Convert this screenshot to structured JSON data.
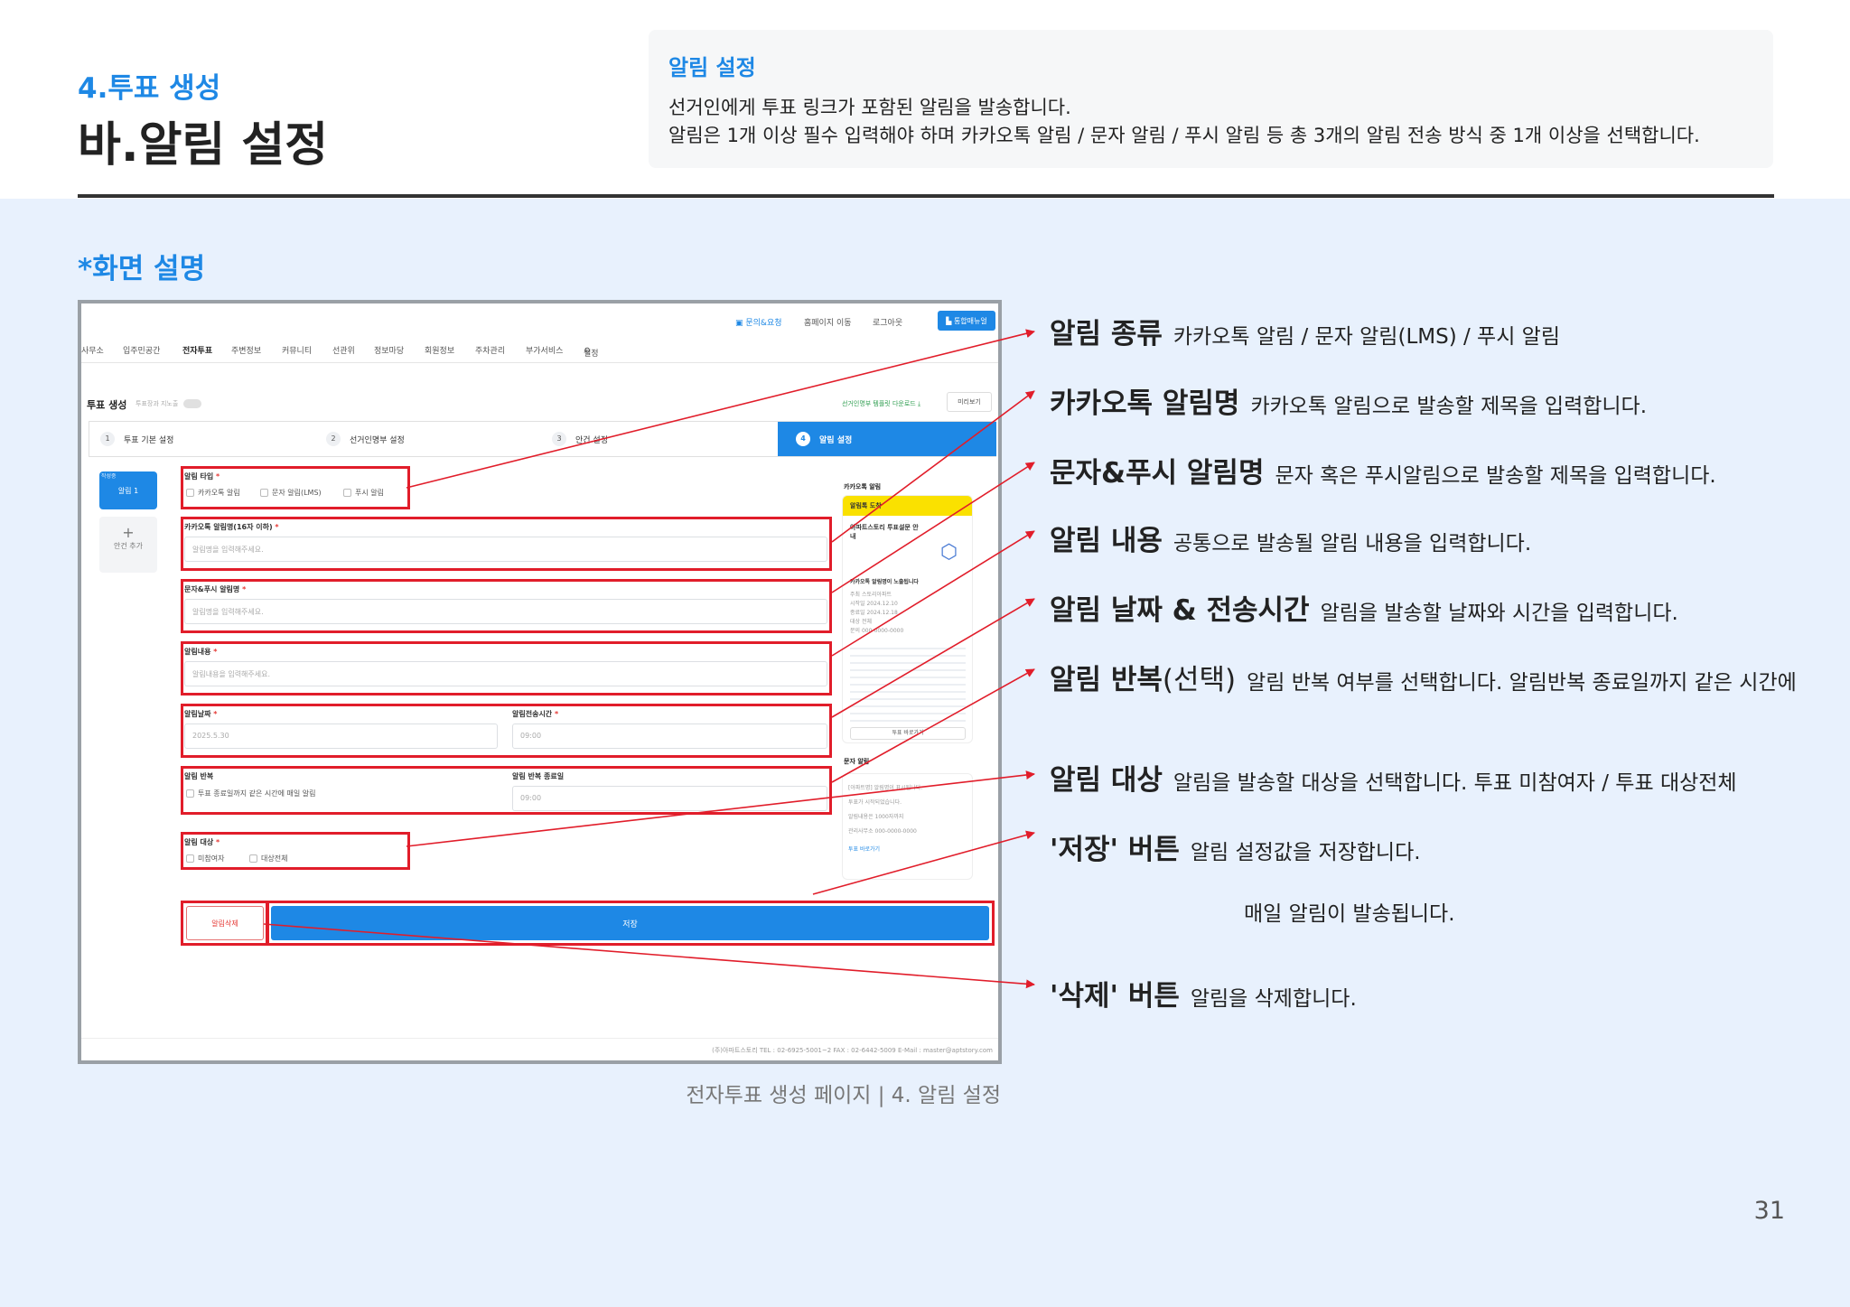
{
  "header": {
    "section_number": "4.투표 생성",
    "title": "바.알림 설정",
    "info_title": "알림 설정",
    "info_lines": [
      "선거인에게 투표 링크가 포함된 알림을 발송합니다.",
      "알림은 1개 이상 필수 입력해야 하며 카카오톡 알림 / 문자 알림 / 푸시 알림 등 총 3개의 알림 전송 방식 중 1개 이상을 선택합니다."
    ]
  },
  "section_title": "*화면 설명",
  "caption": "전자투표 생성 페이지 | 4. 알림 설정",
  "page_number": "31",
  "colors": {
    "accent": "#1e88e5",
    "annotation": "#e11d2a",
    "background": "#e8f1fd"
  },
  "screen": {
    "util": [
      "문의&요청",
      "홈페이지 이동",
      "로그아웃"
    ],
    "util_button": "통합매뉴얼",
    "gnb": [
      "사무소",
      "입주민공간",
      "전자투표",
      "주변정보",
      "커뮤니티",
      "선관위",
      "정보마당",
      "회원정보",
      "주차관리",
      "부가서비스",
      "설정"
    ],
    "page_title": "투표 생성",
    "page_title_hint": "투표장과 지노출",
    "download_link": "선거인명부 템플릿 다운로드",
    "preview_button": "미리보기",
    "steps": [
      {
        "num": "1",
        "label": "투표 기본 설정"
      },
      {
        "num": "2",
        "label": "선거인명부 설정"
      },
      {
        "num": "3",
        "label": "안건 설정"
      },
      {
        "num": "4",
        "label": "알림 설정"
      }
    ],
    "tab_tag": "작성중",
    "tab_label": "알림 1",
    "add_label": "안건 추가",
    "alarm_type_label": "알림 타입",
    "alarm_type_options": [
      "카카오톡 알림",
      "문자 알림(LMS)",
      "푸시 알림"
    ],
    "kakao_name_label": "카카오톡 알림명(16자 이하)",
    "kakao_name_placeholder": "알림명을 입력해주세요.",
    "sms_name_label": "문자&푸시 알림명",
    "sms_name_placeholder": "알림명을 입력해주세요.",
    "content_label": "알림내용",
    "content_placeholder": "알림내용을 입력해주세요.",
    "date_label": "알림날짜",
    "date_value": "2025.5.30",
    "time_label": "알림전송시간",
    "time_value": "09:00",
    "repeat_label": "알림 반복",
    "repeat_option": "투표 종료일까지 같은 시간에 매일 알림",
    "repeat_end_label": "알림 반복 종료일",
    "repeat_end_value": "09:00",
    "target_label": "알림 대상",
    "target_options": [
      "미참여자",
      "대상전체"
    ],
    "delete_button": "알림삭제",
    "save_button": "저장",
    "preview_kakao_title": "카카오톡 알림",
    "preview_kakao_header": "알림톡 도착",
    "preview_kakao_body_title": "아파트스토리 투표설문 안내",
    "preview_kakao_notice": "카카오톡 알림명이 노출됩니다",
    "preview_kakao_rows": [
      "주최 스토리아파트",
      "시작일 2024.12.10",
      "종료일 2024.12.18",
      "대상 전체",
      "문의 000-0000-0000"
    ],
    "preview_kakao_link": "투표 바로가기",
    "preview_sms_title": "문자 알림",
    "preview_sms_lines": [
      "[아파트명] 알림명이 표시됩니다.",
      "투표가 시작되었습니다.",
      "알림내용은 1000자까지",
      "관리사무소 000-0000-0000"
    ],
    "preview_sms_link": "투표 바로가기",
    "footer": "(주)아파트스토리  TEL : 02-6925-5001~2  FAX : 02-6442-5009  E-Mail : master@aptstory.com"
  },
  "annotations": [
    {
      "title": "알림 종류",
      "desc": "카카오톡 알림 / 문자 알림(LMS) / 푸시 알림"
    },
    {
      "title": "카카오톡 알림명",
      "desc": "카카오톡 알림으로 발송할 제목을 입력합니다."
    },
    {
      "title": "문자&푸시 알림명",
      "desc": "문자 혹은 푸시알림으로 발송할 제목을 입력합니다."
    },
    {
      "title": "알림 내용",
      "desc": "공통으로 발송될 알림 내용을 입력합니다."
    },
    {
      "title": "알림 날짜 & 전송시간",
      "desc": "알림을 발송할 날짜와 시간을 입력합니다."
    },
    {
      "title": "알림 반복",
      "title_paren": "(선택)",
      "desc": "알림 반복 여부를 선택합니다. 알림반복 종료일까지 같은 시간에",
      "desc2": "매일 알림이 발송됩니다."
    },
    {
      "title": "알림 대상",
      "desc": "알림을 발송할 대상을 선택합니다. 투표 미참여자 / 투표 대상전체"
    },
    {
      "title": "'저장' 버튼",
      "desc": "알림 설정값을 저장합니다."
    },
    {
      "title": "'삭제' 버튼",
      "desc": "알림을 삭제합니다."
    }
  ]
}
